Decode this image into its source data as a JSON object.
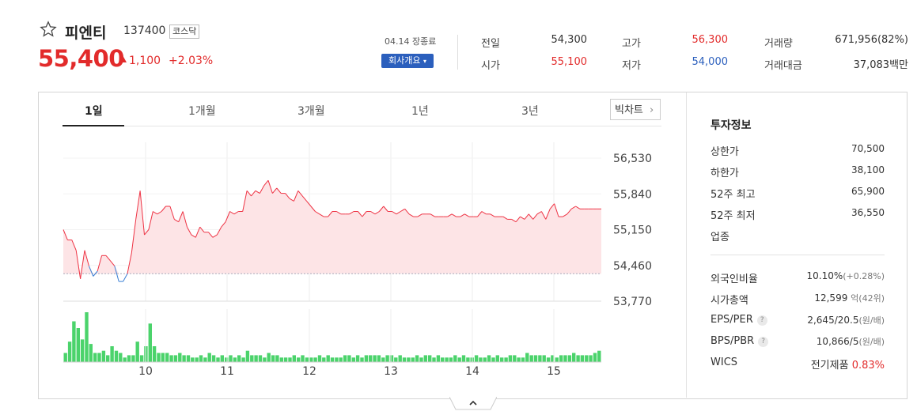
{
  "stock": {
    "name": "피엔티",
    "code": "137400",
    "market": "코스닥",
    "price": "55,400",
    "change": "1,100",
    "change_rate": "+2.03%"
  },
  "summary": {
    "date_label": "04.14 장종료",
    "company_button": "회사개요",
    "items": [
      {
        "label": "전일",
        "value": "54,300",
        "tone": "dark"
      },
      {
        "label": "시가",
        "value": "55,100",
        "tone": "red"
      },
      {
        "label": "고가",
        "value": "56,300",
        "tone": "red"
      },
      {
        "label": "저가",
        "value": "54,000",
        "tone": "blue"
      },
      {
        "label": "거래량",
        "value": "671,956(82%)",
        "tone": "dark"
      },
      {
        "label": "거래대금",
        "value": "37,083백만",
        "tone": "dark"
      }
    ]
  },
  "tabs": [
    "1일",
    "1개월",
    "3개월",
    "1년",
    "3년"
  ],
  "big_chart_label": "빅차트",
  "chart_data": {
    "type": "area",
    "y_ticks": [
      "56,530",
      "55,840",
      "55,150",
      "54,460",
      "53,770"
    ],
    "x_ticks": [
      "10",
      "11",
      "12",
      "13",
      "14",
      "15"
    ],
    "ylim": [
      53770,
      56530
    ],
    "baseline": 54300,
    "price_series": [
      55150,
      54950,
      54950,
      54750,
      54200,
      54750,
      54450,
      54250,
      54350,
      54650,
      54650,
      54550,
      54450,
      54150,
      54150,
      54300,
      54700,
      55350,
      55900,
      55050,
      55150,
      55500,
      55450,
      55500,
      55600,
      55600,
      55350,
      55300,
      55500,
      55200,
      55050,
      55000,
      55200,
      55100,
      55100,
      55000,
      55050,
      55200,
      55300,
      55500,
      55450,
      55500,
      55500,
      55900,
      55800,
      55900,
      55850,
      56000,
      56100,
      55850,
      55950,
      55850,
      55850,
      55750,
      55700,
      55900,
      55800,
      55700,
      55600,
      55500,
      55450,
      55400,
      55400,
      55500,
      55500,
      55450,
      55450,
      55450,
      55500,
      55500,
      55400,
      55500,
      55500,
      55450,
      55500,
      55600,
      55500,
      55500,
      55450,
      55500,
      55550,
      55450,
      55400,
      55400,
      55450,
      55450,
      55450,
      55400,
      55400,
      55400,
      55400,
      55450,
      55400,
      55400,
      55450,
      55400,
      55400,
      55400,
      55500,
      55450,
      55450,
      55400,
      55400,
      55400,
      55350,
      55350,
      55300,
      55400,
      55350,
      55450,
      55350,
      55450,
      55500,
      55350,
      55550,
      55650,
      55400,
      55400,
      55450,
      55550,
      55600,
      55550,
      55550,
      55550,
      55550,
      55550,
      55550
    ],
    "volume_series": [
      4,
      9,
      18,
      15,
      10,
      22,
      8,
      4,
      4,
      5,
      3,
      7,
      5,
      4,
      2,
      3,
      3,
      9,
      3,
      7,
      17,
      7,
      4,
      4,
      4,
      3,
      3,
      4,
      3,
      3,
      2,
      2,
      3,
      2,
      4,
      3,
      2,
      3,
      2,
      3,
      2,
      3,
      2,
      5,
      3,
      3,
      3,
      2,
      4,
      3,
      3,
      2,
      2,
      2,
      3,
      2,
      3,
      2,
      2,
      2,
      3,
      2,
      3,
      2,
      2,
      2,
      3,
      3,
      2,
      3,
      2,
      3,
      3,
      3,
      3,
      2,
      3,
      3,
      2,
      3,
      2,
      2,
      2,
      3,
      2,
      3,
      3,
      2,
      3,
      2,
      2,
      2,
      3,
      2,
      3,
      2,
      2,
      3,
      2,
      2,
      3,
      2,
      3,
      2,
      2,
      3,
      3,
      2,
      2,
      4,
      3,
      3,
      3,
      3,
      2,
      3,
      2,
      3,
      3,
      3,
      4,
      3,
      3,
      3,
      3,
      4,
      5
    ]
  },
  "invest": {
    "title": "투자정보",
    "rows1": [
      {
        "label": "상한가",
        "value": "70,500",
        "tone": "red"
      },
      {
        "label": "하한가",
        "value": "38,100",
        "tone": "blue"
      },
      {
        "label": "52주 최고",
        "value": "65,900",
        "tone": "dark"
      },
      {
        "label": "52주 최저",
        "value": "36,550",
        "tone": "dark"
      },
      {
        "label": "업종",
        "value": "",
        "tone": "dark"
      }
    ],
    "foreign_label": "외국인비율",
    "foreign_value": "10.10%",
    "foreign_change": "(+0.28%)",
    "mcap_label": "시가총액",
    "mcap_value": "12,599",
    "mcap_unit": "억(42위)",
    "eps_label": "EPS/PER",
    "eps_value": "2,645/20.5",
    "eps_unit": "(원/배)",
    "bps_label": "BPS/PBR",
    "bps_value": "10,866/5",
    "bps_unit": "(원/배)",
    "wics_label": "WICS",
    "wics_sector": "전기제품",
    "wics_rate": "0.83%"
  }
}
